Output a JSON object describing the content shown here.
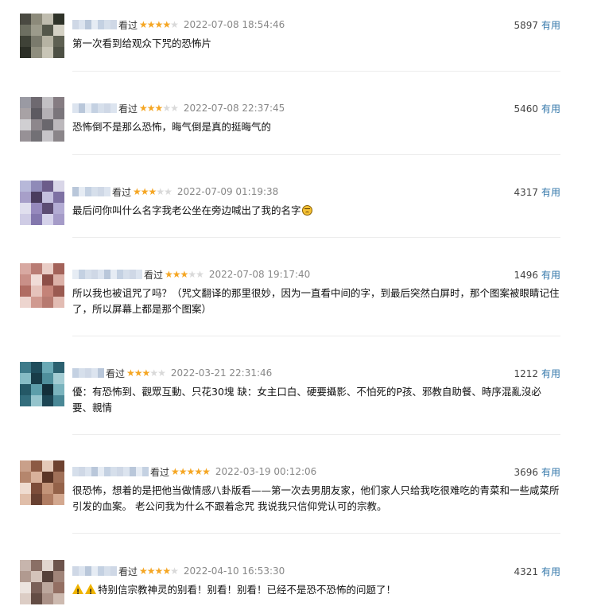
{
  "comments": [
    {
      "watched": "看过",
      "rating": 4,
      "time": "2022-07-08 18:54:46",
      "votes": "5897",
      "useful": "有用",
      "text": "第一次看到给观众下咒的恐怖片",
      "emoji": ""
    },
    {
      "watched": "看过",
      "rating": 3,
      "time": "2022-07-08 22:37:45",
      "votes": "5460",
      "useful": "有用",
      "text": "恐怖倒不是那么恐怖，晦气倒是真的挺晦气的",
      "emoji": ""
    },
    {
      "watched": "看过",
      "rating": 3,
      "time": "2022-07-09 01:19:38",
      "votes": "4317",
      "useful": "有用",
      "text": "最后问你叫什么名字我老公坐在旁边喊出了我的名字",
      "emoji": "upside-down-face-emoji"
    },
    {
      "watched": "看过",
      "rating": 3,
      "time": "2022-07-08 19:17:40",
      "votes": "1496",
      "useful": "有用",
      "text": "所以我也被诅咒了吗？（咒文翻译的那里很妙，因为一直看中间的字，到最后突然白屏时，那个图案被眼睛记住了，所以屏幕上都是那个图案）",
      "emoji": ""
    },
    {
      "watched": "看过",
      "rating": 3,
      "time": "2022-03-21 22:31:46",
      "votes": "1212",
      "useful": "有用",
      "text": "優：有恐怖到、觀眾互動、只花30塊 缺：女主口白、硬要攝影、不怕死的P孩、邪教自助餐、時序混亂沒必要、親情",
      "emoji": ""
    },
    {
      "watched": "看过",
      "rating": 5,
      "time": "2022-03-19 00:12:06",
      "votes": "3696",
      "useful": "有用",
      "text": "很恐怖，想着的是把他当做情感八卦版看——第一次去男朋友家，他们家人只给我吃很难吃的青菜和一些咸菜所引发的血案。 老公问我为什么不跟着念咒 我说我只信仰党认可的宗教。",
      "emoji": ""
    },
    {
      "watched": "看过",
      "rating": 4,
      "time": "2022-04-10 16:53:30",
      "votes": "4321",
      "useful": "有用",
      "text": "特别信宗教神灵的别看！别看！别看！已经不是恐不恐怖的问题了！",
      "emoji": "warning-icon"
    }
  ]
}
